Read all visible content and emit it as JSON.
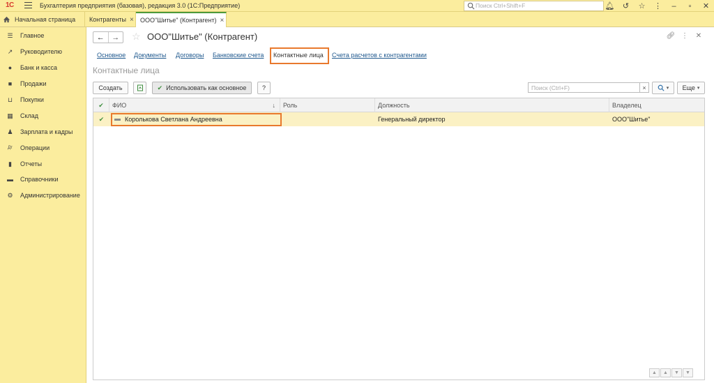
{
  "topbar": {
    "logo": "1С",
    "app_title": "Бухгалтерия предприятия (базовая), редакция 3.0  (1С:Предприятие)",
    "search_placeholder": "Поиск Ctrl+Shift+F"
  },
  "tabs": {
    "home": "Начальная страница",
    "kontragenty": "Контрагенты",
    "active": "ООО\"Шитье\" (Контрагент)"
  },
  "sidebar": {
    "items": [
      {
        "label": "Главное",
        "icon": "menu-icon"
      },
      {
        "label": "Руководителю",
        "icon": "trend-icon"
      },
      {
        "label": "Банк и касса",
        "icon": "coin-icon"
      },
      {
        "label": "Продажи",
        "icon": "bag-icon"
      },
      {
        "label": "Покупки",
        "icon": "cart-icon"
      },
      {
        "label": "Склад",
        "icon": "warehouse-icon"
      },
      {
        "label": "Зарплата и кадры",
        "icon": "person-icon"
      },
      {
        "label": "Операции",
        "icon": "dt-kt-icon"
      },
      {
        "label": "Отчеты",
        "icon": "report-icon"
      },
      {
        "label": "Справочники",
        "icon": "book-icon"
      },
      {
        "label": "Администрирование",
        "icon": "gear-icon"
      }
    ]
  },
  "form": {
    "title": "ООО\"Шитье\" (Контрагент)",
    "links": [
      "Основное",
      "Документы",
      "Договоры",
      "Банковские счета",
      "Контактные лица",
      "Счета расчетов с контрагентами"
    ],
    "current_link": "Контактные лица",
    "section_title": "Контактные лица"
  },
  "toolbar": {
    "create": "Создать",
    "use_as_main": "Использовать как основное",
    "help": "?",
    "search_placeholder": "Поиск (Ctrl+F)",
    "more": "Еще"
  },
  "grid": {
    "columns": [
      "ФИО",
      "Роль",
      "Должность",
      "Владелец"
    ],
    "sort_indicator": "↓",
    "rows": [
      {
        "fio": "Королькова Светлана Андреевна",
        "role": "",
        "position": "Генеральный директор",
        "owner": "ООО\"Шитье\""
      }
    ]
  },
  "colors": {
    "panel_yellow": "#fbed9e",
    "selected_row": "#fbf1c4",
    "highlight_orange": "#e8792d",
    "link_blue": "#215a8f"
  }
}
